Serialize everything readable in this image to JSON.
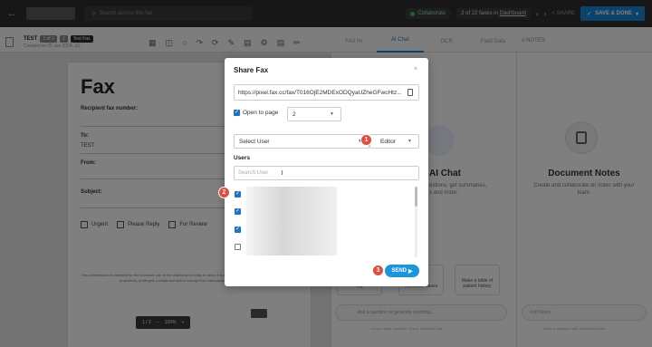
{
  "topbar": {
    "search_placeholder": "Search across this fax",
    "collab_label": "Collaborate",
    "pager_text_pre": "2 of 22 faxes in ",
    "pager_link": "Dashboard",
    "share_label": "SHARE",
    "save_label": "SAVE & DONE"
  },
  "doc": {
    "title": "TEST",
    "tag1": "1 of 2",
    "tag2": "2",
    "tag3": "Test Fax",
    "subtitle": "Created on 20 Jun 2024, 10:",
    "fax_heading": "Fax",
    "recipient_label": "Recipient fax number:",
    "to_label": "To:",
    "to_value": "TEST",
    "from_label": "From:",
    "subject_label": "Subject:",
    "options": [
      "Urgent",
      "Please Reply",
      "For Review"
    ],
    "disclaimer": "This transmission is intended for the exclusive use of the individual or entity to which it is addressed and may contain information that is proprietary, privileged, confidential and/or exempt from disclosure under applicable law.",
    "page_ctrl": "1  /  2",
    "zoom": "100%"
  },
  "right_tabs": [
    "FAX Hi",
    "AI Chat",
    "OCR",
    "Field Data"
  ],
  "ai": {
    "title": "AI Chat",
    "desc_line1": "estions, get summaries,",
    "desc_line2": "s and more.",
    "card1": "Sig",
    "card2": "Important issues",
    "card3": "Make a table of patient history",
    "ask_placeholder": "Ask a question or generate anything...",
    "footer": "AI can make mistakes. Check important info."
  },
  "notes": {
    "tab": "NOTES",
    "title": "Document Notes",
    "desc": "Create and collaborate on notes with your team.",
    "input_placeholder": "Add Notes",
    "footer": "Used to organize with document notes"
  },
  "modal": {
    "title": "Share Fax",
    "close": "×",
    "link": "https://pixel.fax.cc/fax/T016OjE2MDExODQyaUZheGFwcHtz...",
    "open_to_page_label": "Open to page",
    "page_value": "2",
    "user_select": "Select User",
    "role_select": "Editor",
    "users_label": "Users",
    "search_placeholder": "Search User",
    "rows_checked": [
      true,
      true,
      true,
      false
    ],
    "send_label": "SEND"
  },
  "badges": [
    "1",
    "2",
    "3"
  ],
  "colors": {
    "accent": "#1a95e0",
    "badge": "#e74b3c",
    "topbar": "#2f2f31"
  }
}
